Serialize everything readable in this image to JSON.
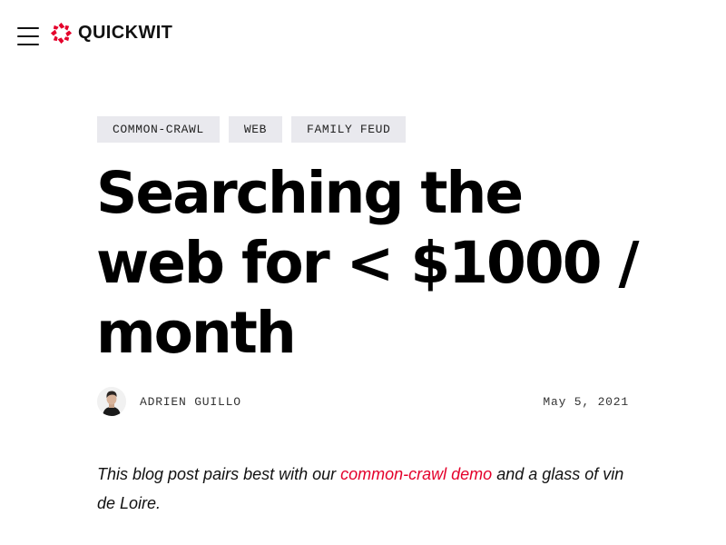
{
  "nav": {
    "menu_icon": "hamburger-menu-icon",
    "logo_icon": "quickwit-logo-icon",
    "brand_name": "QUICKWIT",
    "brand_color": "#e4002b"
  },
  "post": {
    "tags": [
      "COMMON-CRAWL",
      "WEB",
      "FAMILY FEUD"
    ],
    "title": "Searching the web for < $1000 / month",
    "author": "ADRIEN GUILLO",
    "date": "May 5, 2021",
    "intro": {
      "before": "This blog post pairs best with our ",
      "link": "common-crawl demo",
      "after": " and a glass of vin de Loire."
    }
  },
  "colors": {
    "link": "#e4002b",
    "tag_bg": "#e9e9ee",
    "text": "#000000"
  }
}
